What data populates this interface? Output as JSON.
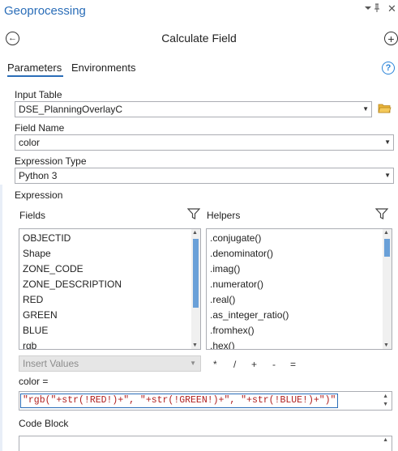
{
  "pane": {
    "title": "Geoprocessing",
    "pin_glyph": "▾  ⬹",
    "close_glyph": "✕"
  },
  "tool": {
    "title": "Calculate Field",
    "back_glyph": "←",
    "add_glyph": "+"
  },
  "tabs": [
    {
      "label": "Parameters",
      "active": true
    },
    {
      "label": "Environments",
      "active": false
    }
  ],
  "help_glyph": "?",
  "params": {
    "input_table": {
      "label": "Input Table",
      "value": "DSE_PlanningOverlayC"
    },
    "field_name": {
      "label": "Field Name",
      "value": "color"
    },
    "expression_type": {
      "label": "Expression Type",
      "value": "Python 3"
    }
  },
  "expression": {
    "section_label": "Expression",
    "fields_label": "Fields",
    "helpers_label": "Helpers",
    "fields": [
      "OBJECTID",
      "Shape",
      "ZONE_CODE",
      "ZONE_DESCRIPTION",
      "RED",
      "GREEN",
      "BLUE",
      "rgb"
    ],
    "helpers": [
      ".conjugate()",
      ".denominator()",
      ".imag()",
      ".numerator()",
      ".real()",
      ".as_integer_ratio()",
      ".fromhex()",
      ".hex()"
    ],
    "insert_values": "Insert Values",
    "operators": [
      "*",
      "/",
      "+",
      "-",
      "="
    ],
    "target_label": "color =",
    "expression_text": "\"rgb(\"+str(!RED!)+\", \"+str(!GREEN!)+\", \"+str(!BLUE!)+\")\"",
    "code_block_label": "Code Block"
  },
  "colors": {
    "accent": "#2a6db8",
    "help": "#2a83d8",
    "folder": "#e8b33a",
    "scroll_thumb": "#6aa0d8",
    "string_token": "#b01e1e"
  }
}
